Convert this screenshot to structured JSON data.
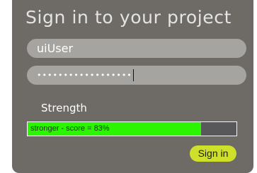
{
  "title": "Sign in to your project",
  "username": {
    "value": "uiUser"
  },
  "password": {
    "masked_value": "••••••••••••••••••"
  },
  "strength": {
    "label": "Strength",
    "meter_text": "stronger - score = 83%",
    "fill_fraction": 0.83
  },
  "signin_button": {
    "label": "Sign in"
  },
  "colors": {
    "panel": "#6e6b67",
    "field": "#a6a4a0",
    "meter_fill": "#2bf500",
    "button": "#cfe02a"
  }
}
